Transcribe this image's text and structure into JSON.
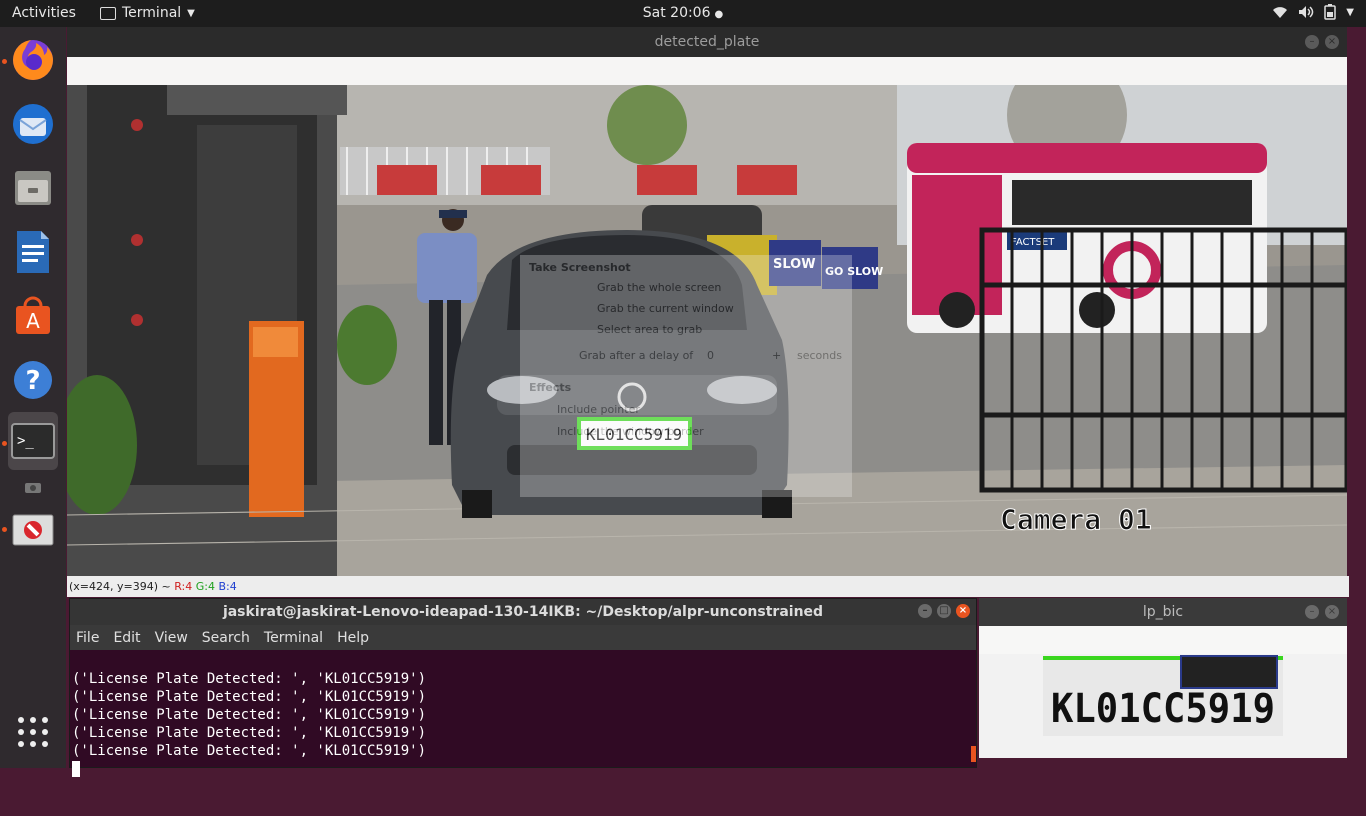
{
  "topbar": {
    "activities": "Activities",
    "app_menu": "Terminal",
    "clock": "Sat 20:06"
  },
  "dock": {
    "items": [
      {
        "icon": "firefox-icon",
        "running": true
      },
      {
        "icon": "thunderbird-icon",
        "running": false
      },
      {
        "icon": "files-icon",
        "running": false
      },
      {
        "icon": "writer-icon",
        "running": false
      },
      {
        "icon": "software-icon",
        "running": false
      },
      {
        "icon": "help-icon",
        "running": false
      },
      {
        "icon": "terminal-icon",
        "running": true
      },
      {
        "icon": "screenshot-icon",
        "running": false
      },
      {
        "icon": "blocked-app-icon",
        "running": true
      },
      {
        "icon": "show-apps-icon",
        "running": false
      }
    ]
  },
  "plate_window": {
    "title": "detected_plate",
    "status": "(x=424, y=394) ~ R:4 G:4 B:4",
    "status_parts": {
      "coords": "(x=424, y=394) ~",
      "r": "R:4",
      "g": "G:4",
      "b": "B:4"
    },
    "scene": {
      "detected_plate_text": "KL01CC5919",
      "camera_label": "Camera 01",
      "sign_1": "SLOW",
      "sign_2": "GO SLOW",
      "bus_logo": "FACTSET",
      "overlay_title": "Take Screenshot",
      "overlay_lines": [
        "Grab the whole screen",
        "Grab the current window",
        "Select area to grab",
        "Grab after a delay of",
        "0",
        "+",
        "seconds",
        "Effects",
        "Include pointer",
        "Include the window border"
      ]
    }
  },
  "terminal": {
    "title": "jaskirat@jaskirat-Lenovo-ideapad-130-14IKB: ~/Desktop/alpr-unconstrained",
    "menu": [
      "File",
      "Edit",
      "View",
      "Search",
      "Terminal",
      "Help"
    ],
    "lines": [
      "('License Plate Detected: ', 'KL01CC5919')",
      "('License Plate Detected: ', 'KL01CC5919')",
      "('License Plate Detected: ', 'KL01CC5919')",
      "('License Plate Detected: ', 'KL01CC5919')",
      "('License Plate Detected: ', 'KL01CC5919')"
    ]
  },
  "lp_window": {
    "title": "lp_bic",
    "plate_text": "KL01CC5919"
  },
  "colors": {
    "accent": "#e95420",
    "terminal_bg": "#300a24",
    "detect_box": "#3ad61f"
  }
}
